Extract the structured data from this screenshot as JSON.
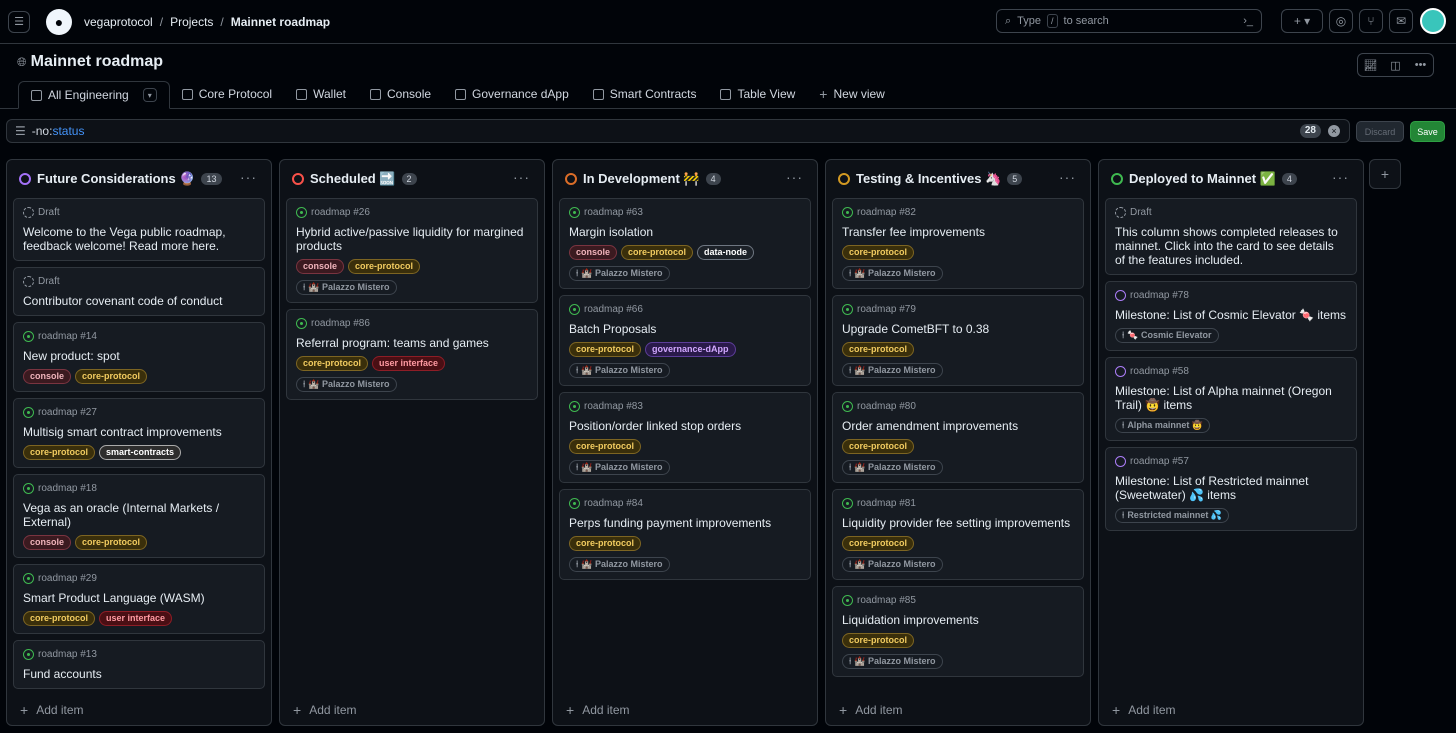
{
  "breadcrumbs": {
    "org": "vegaprotocol",
    "projects": "Projects",
    "current": "Mainnet roadmap"
  },
  "search": {
    "text": "Type",
    "key": "/",
    "suffix": "to search"
  },
  "project": {
    "title": "Mainnet roadmap"
  },
  "tabs": [
    {
      "label": "All Engineering"
    },
    {
      "label": "Core Protocol"
    },
    {
      "label": "Wallet"
    },
    {
      "label": "Console"
    },
    {
      "label": "Governance dApp"
    },
    {
      "label": "Smart Contracts"
    },
    {
      "label": "Table View"
    },
    {
      "label": "New view"
    }
  ],
  "filter": {
    "prefix": "-no:",
    "field": "status",
    "count": "28"
  },
  "actions": {
    "discard": "Discard",
    "save": "Save"
  },
  "add_item": "Add item",
  "columns": [
    {
      "name": "Future Considerations 🔮",
      "count": "13",
      "ring": "#a371f7",
      "cards": [
        {
          "status": "draft",
          "ref": "Draft",
          "title": "Welcome to the Vega public roadmap, feedback welcome! Read more here.",
          "labels": []
        },
        {
          "status": "draft",
          "ref": "Draft",
          "title": "Contributor covenant code of conduct",
          "labels": []
        },
        {
          "status": "open",
          "ref": "roadmap #14",
          "title": "New product: spot",
          "labels": [
            "console",
            "core-protocol"
          ]
        },
        {
          "status": "open",
          "ref": "roadmap #27",
          "title": "Multisig smart contract improvements",
          "labels": [
            "core-protocol",
            "smart-contracts"
          ]
        },
        {
          "status": "open",
          "ref": "roadmap #18",
          "title": "Vega as an oracle (Internal Markets / External)",
          "labels": [
            "console",
            "core-protocol"
          ]
        },
        {
          "status": "open",
          "ref": "roadmap #29",
          "title": "Smart Product Language (WASM)",
          "labels": [
            "core-protocol",
            "user interface"
          ]
        },
        {
          "status": "open",
          "ref": "roadmap #13",
          "title": "Fund accounts",
          "labels": []
        }
      ]
    },
    {
      "name": "Scheduled 🔜",
      "count": "2",
      "ring": "#f85149",
      "cards": [
        {
          "status": "open",
          "ref": "roadmap #26",
          "title": "Hybrid active/passive liquidity for margined products",
          "labels": [
            "console",
            "core-protocol"
          ],
          "milestone": "🏰 Palazzo Mistero"
        },
        {
          "status": "open",
          "ref": "roadmap #86",
          "title": "Referral program: teams and games",
          "labels": [
            "core-protocol",
            "user interface"
          ],
          "milestone": "🏰 Palazzo Mistero"
        }
      ]
    },
    {
      "name": "In Development 🚧",
      "count": "4",
      "ring": "#db6d28",
      "cards": [
        {
          "status": "open",
          "ref": "roadmap #63",
          "title": "Margin isolation",
          "labels": [
            "console",
            "core-protocol",
            "data-node"
          ],
          "milestone": "🏰 Palazzo Mistero"
        },
        {
          "status": "open",
          "ref": "roadmap #66",
          "title": "Batch Proposals",
          "labels": [
            "core-protocol",
            "governance-dApp"
          ],
          "milestone": "🏰 Palazzo Mistero"
        },
        {
          "status": "open",
          "ref": "roadmap #83",
          "title": "Position/order linked stop orders",
          "labels": [
            "core-protocol"
          ],
          "milestone": "🏰 Palazzo Mistero"
        },
        {
          "status": "open",
          "ref": "roadmap #84",
          "title": "Perps funding payment improvements",
          "labels": [
            "core-protocol"
          ],
          "milestone": "🏰 Palazzo Mistero"
        }
      ]
    },
    {
      "name": "Testing & Incentives 🦄",
      "count": "5",
      "ring": "#d29922",
      "cards": [
        {
          "status": "open",
          "ref": "roadmap #82",
          "title": "Transfer fee improvements",
          "labels": [
            "core-protocol"
          ],
          "milestone": "🏰 Palazzo Mistero"
        },
        {
          "status": "open",
          "ref": "roadmap #79",
          "title": "Upgrade CometBFT to 0.38",
          "labels": [
            "core-protocol"
          ],
          "milestone": "🏰 Palazzo Mistero"
        },
        {
          "status": "open",
          "ref": "roadmap #80",
          "title": "Order amendment improvements",
          "labels": [
            "core-protocol"
          ],
          "milestone": "🏰 Palazzo Mistero"
        },
        {
          "status": "open",
          "ref": "roadmap #81",
          "title": "Liquidity provider fee setting improvements",
          "labels": [
            "core-protocol"
          ],
          "milestone": "🏰 Palazzo Mistero"
        },
        {
          "status": "open",
          "ref": "roadmap #85",
          "title": "Liquidation improvements",
          "labels": [
            "core-protocol"
          ],
          "milestone": "🏰 Palazzo Mistero"
        }
      ]
    },
    {
      "name": "Deployed to Mainnet ✅",
      "count": "4",
      "ring": "#3fb950",
      "cards": [
        {
          "status": "draft",
          "ref": "Draft",
          "title": "This column shows completed releases to mainnet. Click into the card to see details of the features included.",
          "labels": []
        },
        {
          "status": "done",
          "ref": "roadmap #78",
          "title": "Milestone: List of Cosmic Elevator 🍬 items",
          "labels": [],
          "milestone": "🍬 Cosmic Elevator"
        },
        {
          "status": "done",
          "ref": "roadmap #58",
          "title": "Milestone: List of Alpha mainnet (Oregon Trail) 🤠 items",
          "labels": [],
          "milestone": "Alpha mainnet 🤠"
        },
        {
          "status": "done",
          "ref": "roadmap #57",
          "title": "Milestone: List of Restricted mainnet (Sweetwater) 💦 items",
          "labels": [],
          "milestone": "Restricted mainnet 💦"
        }
      ]
    }
  ]
}
